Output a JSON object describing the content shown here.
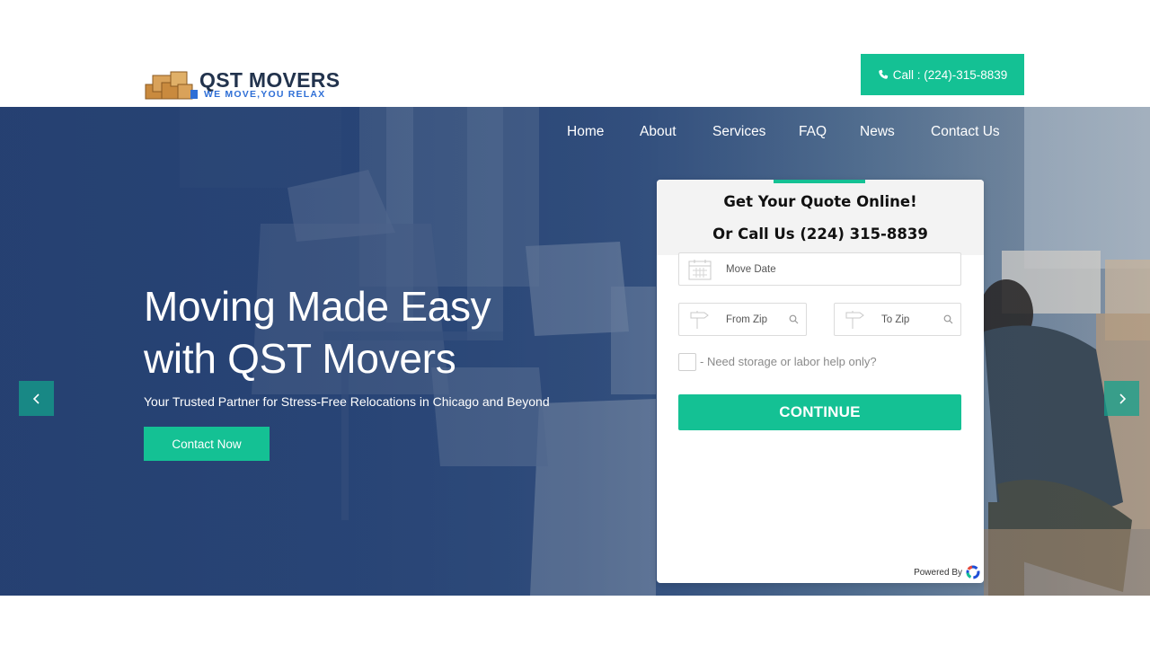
{
  "header": {
    "logo_title": "QST MOVERS",
    "logo_tagline": "WE MOVE,YOU RELAX",
    "call_label": "Call : (224)-315-8839"
  },
  "nav": {
    "items": [
      "Home",
      "About",
      "Services",
      "FAQ",
      "News",
      "Contact Us"
    ]
  },
  "hero": {
    "headline_line1": "Moving Made Easy",
    "headline_line2": "with QST Movers",
    "subheadline": "Your Trusted Partner for Stress-Free Relocations in Chicago and Beyond",
    "cta_label": "Contact Now",
    "prev_icon": "chevron-left-icon",
    "next_icon": "chevron-right-icon"
  },
  "quote_form": {
    "title": "Get Your Quote Online!",
    "subtitle": "Or Call Us (224) 315-8839",
    "move_date_placeholder": "Move Date",
    "from_zip_placeholder": "From Zip",
    "to_zip_placeholder": "To Zip",
    "storage_label": "- Need storage or labor help only?",
    "continue_label": "CONTINUE",
    "powered_by": "Powered By"
  },
  "colors": {
    "accent": "#14c194",
    "hero_blue": "#29477a",
    "logo_navy": "#22334d",
    "tagline_blue": "#2f6fd6"
  }
}
